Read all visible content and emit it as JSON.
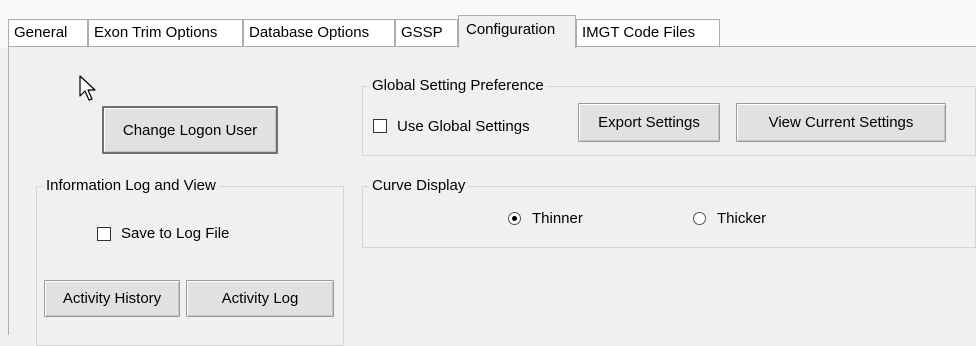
{
  "tabs": [
    {
      "label": "General"
    },
    {
      "label": "Exon Trim Options"
    },
    {
      "label": "Database Options"
    },
    {
      "label": "GSSP"
    },
    {
      "label": "Configuration",
      "active": true
    },
    {
      "label": "IMGT Code Files"
    }
  ],
  "configuration": {
    "change_logon_user_label": "Change Logon User",
    "global_setting": {
      "title": "Global Setting Preference",
      "use_global_label": "Use Global Settings",
      "use_global_checked": false,
      "export_label": "Export Settings",
      "view_current_label": "View Current Settings"
    },
    "info_log": {
      "title": "Information Log and View",
      "save_log_label": "Save to Log File",
      "save_log_checked": false,
      "activity_history_label": "Activity History",
      "activity_log_label": "Activity Log"
    },
    "curve_display": {
      "title": "Curve Display",
      "thinner_label": "Thinner",
      "thicker_label": "Thicker",
      "selected": "Thinner"
    }
  },
  "cursor": {
    "icon": "mouse-pointer-icon"
  }
}
